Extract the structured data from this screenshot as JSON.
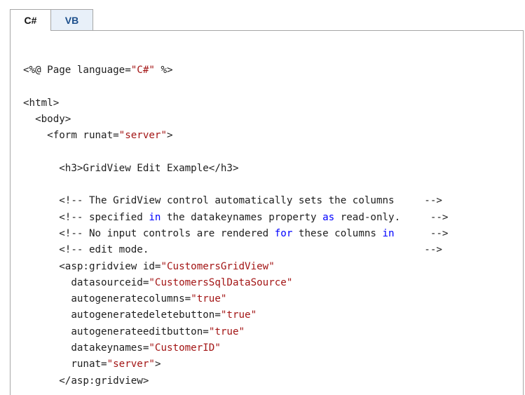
{
  "tabs": [
    {
      "label": "C#",
      "selected": true
    },
    {
      "label": "VB",
      "selected": false
    }
  ],
  "colors": {
    "text": "#1e1e1e",
    "string": "#a31515",
    "keyword": "#0000ff",
    "tab_inactive_bg": "#e8f0f9",
    "tab_inactive_text": "#1c4f8c",
    "border": "#a6a6a6"
  },
  "code_lines": [
    {
      "indent": 0,
      "tokens": [
        {
          "t": "<%@ Page language="
        },
        {
          "t": "\"C#\"",
          "c": "str"
        },
        {
          "t": " %>"
        }
      ]
    },
    {
      "indent": 0,
      "tokens": []
    },
    {
      "indent": 0,
      "tokens": [
        {
          "t": "<html>"
        }
      ]
    },
    {
      "indent": 2,
      "tokens": [
        {
          "t": "<body>"
        }
      ]
    },
    {
      "indent": 4,
      "tokens": [
        {
          "t": "<form runat="
        },
        {
          "t": "\"server\"",
          "c": "str"
        },
        {
          "t": ">"
        }
      ]
    },
    {
      "indent": 0,
      "tokens": []
    },
    {
      "indent": 6,
      "tokens": [
        {
          "t": "<h3>GridView Edit Example</h3>"
        }
      ]
    },
    {
      "indent": 0,
      "tokens": []
    },
    {
      "indent": 6,
      "tokens": [
        {
          "t": "<!-- The GridView control automatically sets the columns     -->"
        }
      ]
    },
    {
      "indent": 6,
      "tokens": [
        {
          "t": "<!-- specified "
        },
        {
          "t": "in",
          "c": "kw"
        },
        {
          "t": " the datakeynames property "
        },
        {
          "t": "as",
          "c": "kw"
        },
        {
          "t": " read-only.     -->"
        }
      ]
    },
    {
      "indent": 6,
      "tokens": [
        {
          "t": "<!-- No input controls are rendered "
        },
        {
          "t": "for",
          "c": "kw"
        },
        {
          "t": " these columns "
        },
        {
          "t": "in",
          "c": "kw"
        },
        {
          "t": "      -->"
        }
      ]
    },
    {
      "indent": 6,
      "tokens": [
        {
          "t": "<!-- edit mode.                                              -->"
        }
      ]
    },
    {
      "indent": 6,
      "tokens": [
        {
          "t": "<asp:gridview id="
        },
        {
          "t": "\"CustomersGridView\"",
          "c": "str"
        }
      ]
    },
    {
      "indent": 8,
      "tokens": [
        {
          "t": "datasourceid="
        },
        {
          "t": "\"CustomersSqlDataSource\"",
          "c": "str"
        }
      ]
    },
    {
      "indent": 8,
      "tokens": [
        {
          "t": "autogeneratecolumns="
        },
        {
          "t": "\"true\"",
          "c": "str"
        }
      ]
    },
    {
      "indent": 8,
      "tokens": [
        {
          "t": "autogeneratedeletebutton="
        },
        {
          "t": "\"true\"",
          "c": "str"
        }
      ]
    },
    {
      "indent": 8,
      "tokens": [
        {
          "t": "autogenerateeditbutton="
        },
        {
          "t": "\"true\"",
          "c": "str"
        }
      ]
    },
    {
      "indent": 8,
      "tokens": [
        {
          "t": "datakeynames="
        },
        {
          "t": "\"CustomerID\"",
          "c": "str"
        }
      ]
    },
    {
      "indent": 8,
      "tokens": [
        {
          "t": "runat="
        },
        {
          "t": "\"server\"",
          "c": "str"
        },
        {
          "t": ">"
        }
      ]
    },
    {
      "indent": 6,
      "tokens": [
        {
          "t": "</asp:gridview>"
        }
      ]
    }
  ]
}
